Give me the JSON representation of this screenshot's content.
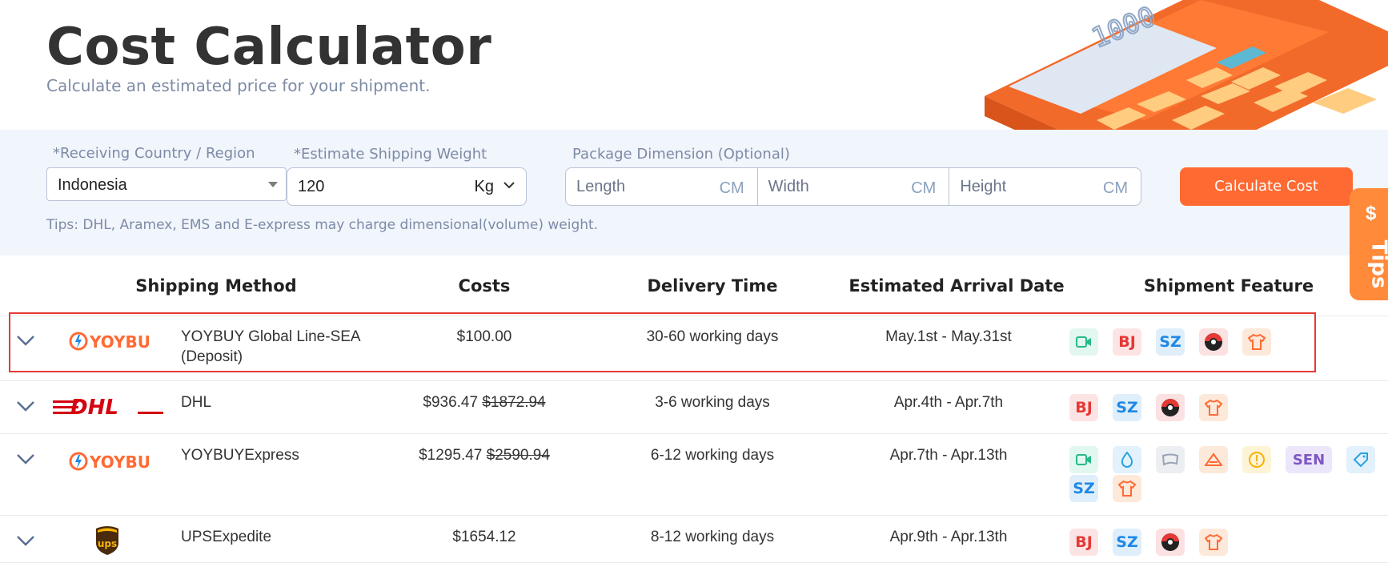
{
  "page": {
    "title": "Cost Calculator",
    "subtitle": "Calculate an estimated price for your shipment."
  },
  "calculator_display": "1000",
  "form": {
    "country_label": "*Receiving Country / Region",
    "country_value": "Indonesia",
    "weight_label": "*Estimate Shipping Weight",
    "weight_value": "120",
    "weight_unit": "Kg",
    "dimension_label": "Package Dimension (Optional)",
    "length_placeholder": "Length",
    "width_placeholder": "Width",
    "height_placeholder": "Height",
    "dimension_unit": "CM",
    "calculate_label": "Calculate Cost",
    "tips": "Tips: DHL, Aramex, EMS and E-express may charge dimensional(volume) weight."
  },
  "tips_tab": {
    "symbol": "$",
    "label": "Tips"
  },
  "table": {
    "headers": [
      "Shipping Method",
      "Costs",
      "Delivery Time",
      "Estimated Arrival Date",
      "Shipment Feature"
    ],
    "rows": [
      {
        "logo": "YOYBUY",
        "method_line1": "YOYBUY Global Line-SEA",
        "method_line2": "(Deposit)",
        "cost": "$100.00",
        "cost_original": "",
        "delivery": "30-60 working days",
        "arrival": "May.1st - May.31st",
        "features": [
          "video-icon",
          "BJ",
          "SZ",
          "pokeball-icon",
          "shirt-icon"
        ]
      },
      {
        "logo": "DHL",
        "method_line1": "DHL",
        "cost": "$936.47",
        "cost_original": "$1872.94",
        "delivery": "3-6 working days",
        "arrival": "Apr.4th - Apr.7th",
        "features": [
          "BJ",
          "SZ",
          "pokeball-icon",
          "shirt-icon"
        ]
      },
      {
        "logo": "YOYBUY",
        "method_line1": "YOYBUYExpress",
        "cost": "$1295.47",
        "cost_original": "$2590.94",
        "delivery": "6-12 working days",
        "arrival": "Apr.7th - Apr.13th",
        "features": [
          "video-icon",
          "drop-icon",
          "cloth-icon",
          "triangle-icon",
          "warning-icon",
          "SEN",
          "tag-icon",
          "SZ",
          "shirt-icon"
        ]
      },
      {
        "logo": "ups",
        "method_line1": "UPSExpedite",
        "cost": "$1654.12",
        "cost_original": "",
        "delivery": "8-12 working days",
        "arrival": "Apr.9th - Apr.13th",
        "features": [
          "BJ",
          "SZ",
          "pokeball-icon",
          "shirt-icon"
        ]
      }
    ]
  },
  "colors": {
    "accent": "#ff6a33",
    "panel_bg": "#f1f5fc",
    "highlight": "#e53935"
  }
}
